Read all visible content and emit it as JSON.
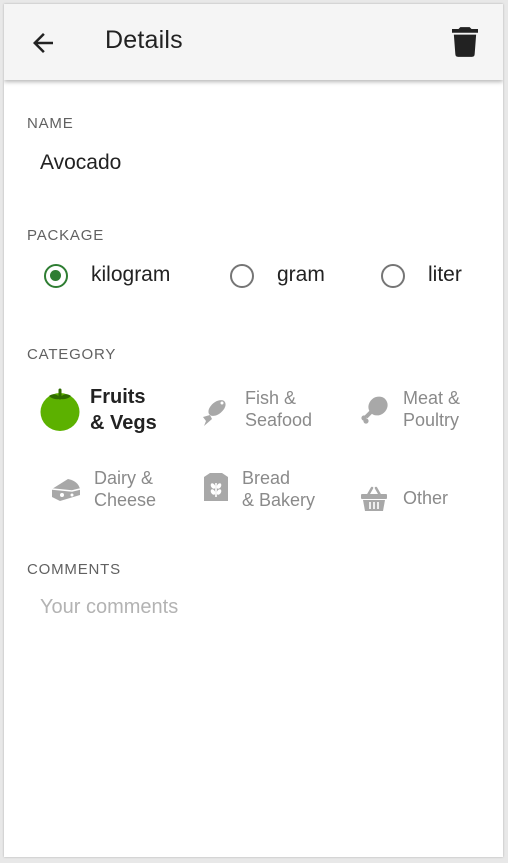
{
  "header": {
    "title": "Details",
    "back_icon": "arrow-back-icon",
    "delete_icon": "trash-icon"
  },
  "name": {
    "label": "NAME",
    "value": "Avocado"
  },
  "package": {
    "label": "PACKAGE",
    "options": [
      "kilogram",
      "gram",
      "liter"
    ],
    "selected": "kilogram"
  },
  "category": {
    "label": "CATEGORY",
    "items": [
      {
        "line1": "Fruits",
        "line2": "& Vegs",
        "icon": "tomato-icon",
        "selected": true
      },
      {
        "line1": "Fish &",
        "line2": "Seafood",
        "icon": "fish-icon",
        "selected": false
      },
      {
        "line1": "Meat &",
        "line2": "Poultry",
        "icon": "drumstick-icon",
        "selected": false
      },
      {
        "line1": "Dairy &",
        "line2": "Cheese",
        "icon": "cheese-icon",
        "selected": false
      },
      {
        "line1": "Bread",
        "line2": "& Bakery",
        "icon": "bread-icon",
        "selected": false
      },
      {
        "line1": "Other",
        "line2": "",
        "icon": "basket-icon",
        "selected": false
      }
    ]
  },
  "comments": {
    "label": "COMMENTS",
    "placeholder": "Your comments"
  },
  "colors": {
    "accent": "#2e7d32",
    "selected_category": "#5cb100",
    "muted_icon": "#a8a8a8",
    "app_bar": "#f5f5f5"
  }
}
